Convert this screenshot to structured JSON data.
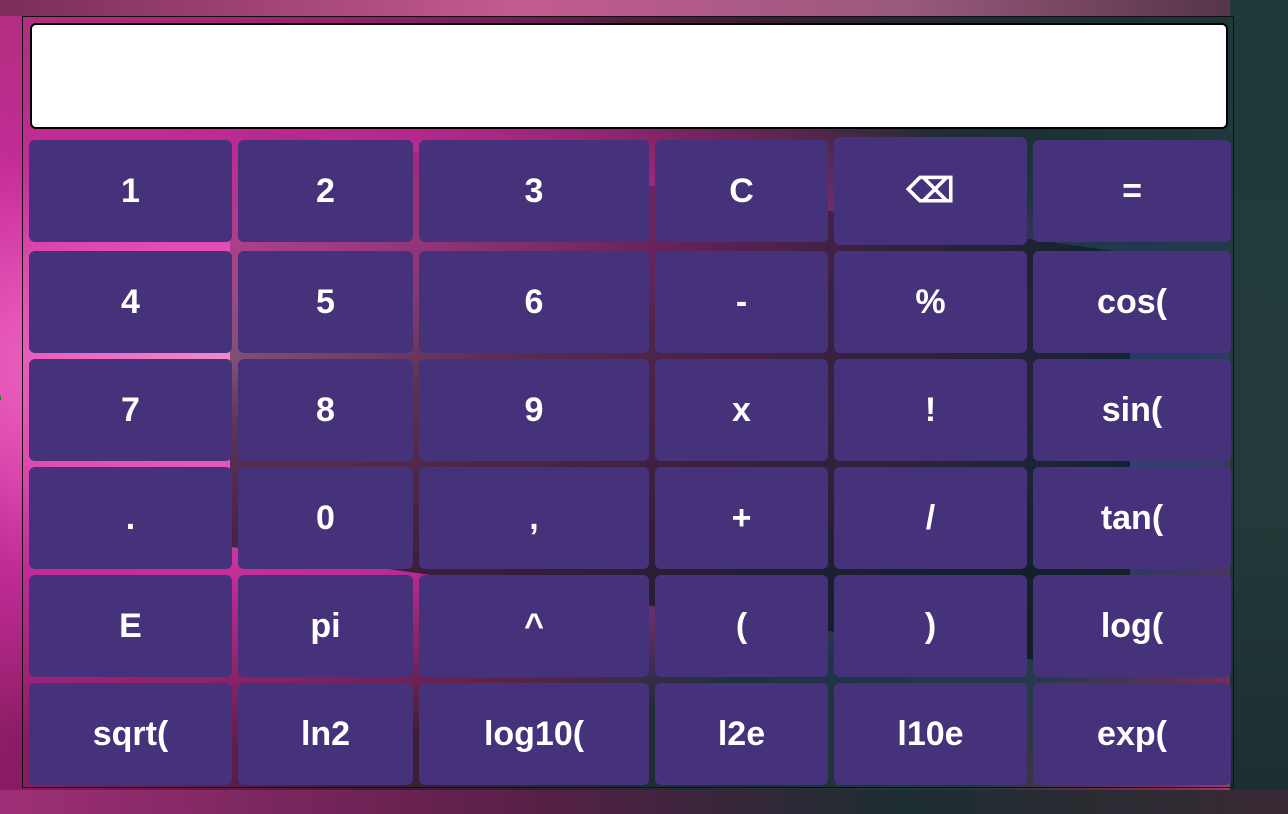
{
  "side_title": "r",
  "display": {
    "value": "",
    "placeholder": ""
  },
  "keys": [
    [
      "1",
      "2",
      "3",
      "C",
      "⌫",
      "="
    ],
    [
      "4",
      "5",
      "6",
      "-",
      "%",
      "cos("
    ],
    [
      "7",
      "8",
      "9",
      "x",
      "!",
      "sin("
    ],
    [
      ".",
      "0",
      ",",
      "+",
      "/",
      "tan("
    ],
    [
      "E",
      "pi",
      "^",
      "(",
      ")",
      "log("
    ],
    [
      "sqrt(",
      "ln2",
      "log10(",
      "l2e",
      "l10e",
      "exp("
    ]
  ],
  "colors": {
    "key_background": "#46327a",
    "key_text": "#ffffff",
    "side_title": "#0a8a0a"
  }
}
